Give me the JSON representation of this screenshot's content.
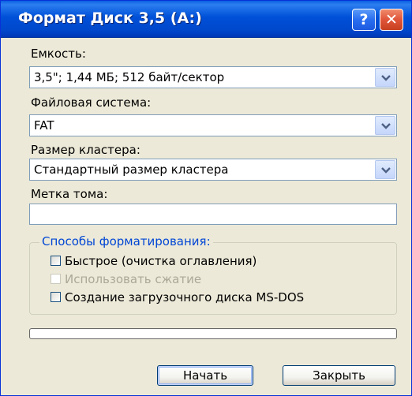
{
  "window": {
    "title": "Формат Диск 3,5 (A:)",
    "help_glyph": "?",
    "close_glyph": "✕"
  },
  "capacity": {
    "label": "Емкость:",
    "value": "3,5\";  1,44 МБ; 512 байт/сектор"
  },
  "filesystem": {
    "label": "Файловая система:",
    "value": "FAT"
  },
  "cluster_size": {
    "label": "Размер кластера:",
    "value": "Стандартный размер кластера"
  },
  "volume_label": {
    "label": "Метка тома:",
    "value": ""
  },
  "format_options": {
    "title": "Способы форматирования:",
    "options": [
      {
        "label": "Быстрое (очистка оглавления)",
        "checked": false,
        "enabled": true
      },
      {
        "label": "Использовать сжатие",
        "checked": false,
        "enabled": false
      },
      {
        "label": "Создание загрузочного диска MS-DOS",
        "checked": false,
        "enabled": true
      }
    ]
  },
  "progress": {
    "value": 0
  },
  "buttons": {
    "start": "Начать",
    "close": "Закрыть"
  },
  "colors": {
    "titlebar": "#0050d8",
    "dialog_bg": "#ece9d8",
    "group_title": "#0046d5",
    "disabled_text": "#aca899"
  },
  "icons": {
    "dropdown": "chevron-down-icon",
    "help": "help-icon",
    "close": "close-icon"
  }
}
